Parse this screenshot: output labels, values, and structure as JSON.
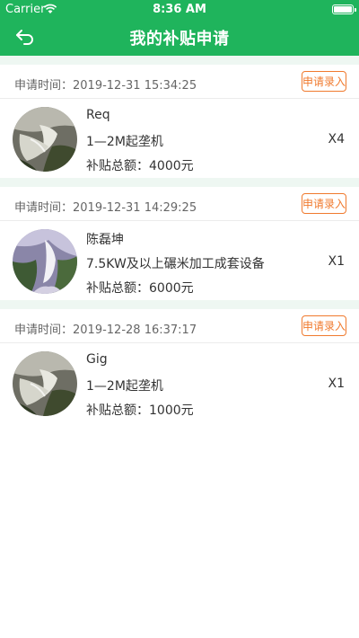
{
  "status_bar": {
    "carrier": "Carrier",
    "time": "8:36 AM"
  },
  "nav": {
    "title": "我的补贴申请",
    "back_icon": "back-arrow-icon"
  },
  "colors": {
    "header": "#1fb45c",
    "accent": "#f07a2e",
    "separator": "#eef7f2"
  },
  "applications": [
    {
      "time_label": "申请时间：",
      "time": "2019-12-31 15:34:25",
      "action_label": "申请录入",
      "name": "Req",
      "item": "1—2M起垄机",
      "quantity": "X4",
      "total_label": "补贴总额：",
      "total": "4000元",
      "avatar_icon": "waterfall-photo"
    },
    {
      "time_label": "申请时间：",
      "time": "2019-12-31 14:29:25",
      "action_label": "申请录入",
      "name": "陈磊坤",
      "item": "7.5KW及以上碾米加工成套设备",
      "quantity": "X1",
      "total_label": "补贴总额：",
      "total": "6000元",
      "avatar_icon": "waterfall-photo"
    },
    {
      "time_label": "申请时间：",
      "time": "2019-12-28 16:37:17",
      "action_label": "申请录入",
      "name": "Gig",
      "item": "1—2M起垄机",
      "quantity": "X1",
      "total_label": "补贴总额：",
      "total": "1000元",
      "avatar_icon": "waterfall-photo"
    }
  ]
}
